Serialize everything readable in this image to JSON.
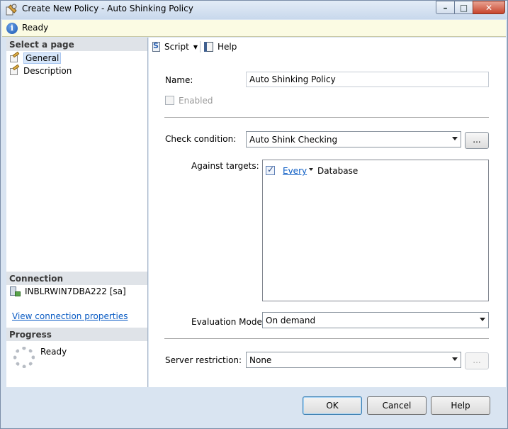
{
  "window": {
    "title": "Create New Policy - Auto Shinking Policy",
    "buttons": {
      "minimize": "–",
      "maximize": "□",
      "close": "✕"
    }
  },
  "status": {
    "icon": "info-icon",
    "text": "Ready"
  },
  "left_panel": {
    "select_page_header": "Select a page",
    "pages": [
      {
        "label": "General",
        "icon": "page-edit-icon",
        "selected": true
      },
      {
        "label": "Description",
        "icon": "page-edit-icon",
        "selected": false
      }
    ],
    "connection_header": "Connection",
    "connection": {
      "server": "INBLRWIN7DBA222 [sa]",
      "icon": "server-icon"
    },
    "connection_link": "View connection properties",
    "progress_header": "Progress",
    "progress_text": "Ready"
  },
  "toolbar": {
    "script_label": "Script",
    "help_label": "Help"
  },
  "form": {
    "name_label": "Name:",
    "name_value": "Auto Shinking Policy",
    "enabled_label": "Enabled",
    "enabled_checked": false,
    "check_condition_label": "Check condition:",
    "check_condition_value": "Auto Shink Checking",
    "ellipsis": "...",
    "against_targets_label": "Against targets:",
    "target": {
      "checked": true,
      "scope": "Every",
      "object": "Database"
    },
    "evaluation_mode_label": "Evaluation Mode:",
    "evaluation_mode_value": "On demand",
    "server_restriction_label": "Server restriction:",
    "server_restriction_value": "None"
  },
  "footer": {
    "ok": "OK",
    "cancel": "Cancel",
    "help": "Help"
  }
}
